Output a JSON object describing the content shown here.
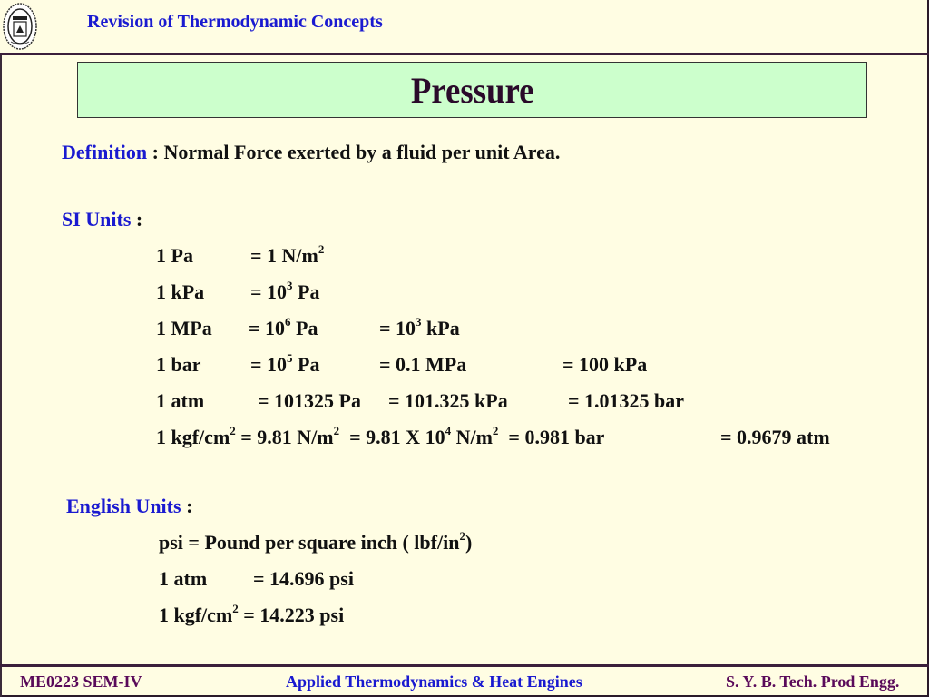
{
  "header": {
    "title": "Revision of Thermodynamic Concepts",
    "logo": "institution-emblem-icon"
  },
  "slide": {
    "title": "Pressure",
    "definition": {
      "label": "Definition",
      "sep": " : ",
      "text": "Normal Force exerted by a fluid per unit Area."
    },
    "si_units": {
      "label": "SI Units",
      "sep": " :",
      "rows": [
        {
          "c1": "1 Pa",
          "c2": [
            "= 1 N/m",
            "2",
            ""
          ],
          "c3": null,
          "c4": null
        },
        {
          "c1": "1 kPa",
          "c2": [
            "= 10",
            "3",
            " Pa"
          ],
          "c3": null,
          "c4": null
        },
        {
          "c1": "1 MPa",
          "c2": [
            "= 10",
            "6",
            " Pa"
          ],
          "c3": [
            "=  10",
            "3",
            " kPa"
          ],
          "c4": null
        },
        {
          "c1": "1 bar",
          "c2": [
            "= 10",
            "5",
            " Pa"
          ],
          "c3": [
            "=  0.1 MPa",
            "",
            ""
          ],
          "c4": "=  100 kPa"
        }
      ],
      "atm_row": {
        "c1": "1 atm",
        "c2": "= 101325 Pa",
        "c3": "= 101.325 kPa",
        "c4": "=  1.01325 bar"
      },
      "kgf_row": {
        "a": "1 kgf/cm",
        "a_sup": "2",
        "b": " = 9.81 N/m",
        "b_sup": "2",
        "c": "  = 9.81 X 10",
        "c_sup": "4",
        "d": " N/m",
        "d_sup": "2",
        "e": "  = 0.981 bar",
        "f": "= 0.9679 atm"
      }
    },
    "english_units": {
      "label": "English Units",
      "sep": " :",
      "psi_def": {
        "text": "psi = Pound per square inch ( lbf/in",
        "sup": "2",
        "end": ")"
      },
      "atm": {
        "c1": "1 atm",
        "c2": "= 14.696 psi"
      },
      "kgf": {
        "a": "1 kgf/cm",
        "sup": "2",
        "b": " = 14.223 psi"
      }
    }
  },
  "footer": {
    "left": "ME0223 SEM-IV",
    "center": "Applied Thermodynamics & Heat Engines",
    "right": "S. Y. B. Tech. Prod Engg."
  }
}
